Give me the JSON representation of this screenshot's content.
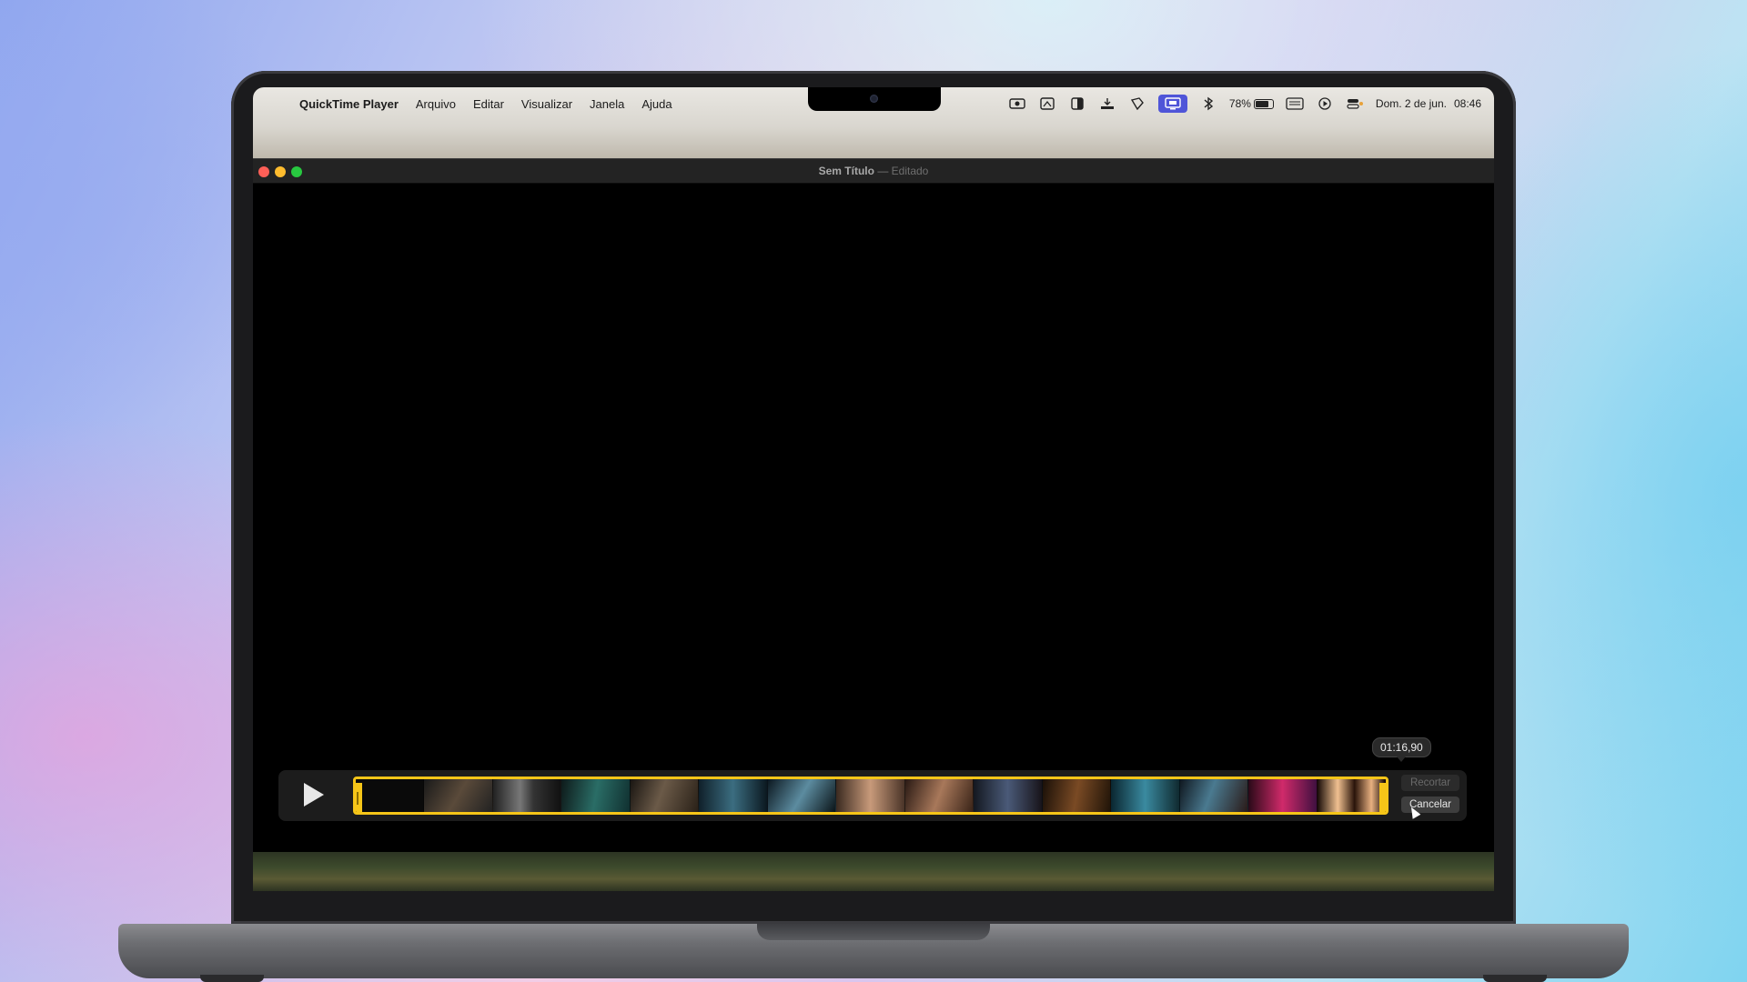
{
  "menubar": {
    "apple_icon": "",
    "app_name": "QuickTime Player",
    "menus": [
      "Arquivo",
      "Editar",
      "Visualizar",
      "Janela",
      "Ajuda"
    ],
    "status_icons": [
      "camera-record-icon",
      "screen-mirror-icon",
      "contrast-icon",
      "download-icon",
      "bookmark-icon",
      "display-share-icon",
      "bluetooth-icon"
    ],
    "battery_percent": "78%",
    "date": "Dom. 2 de jun.",
    "time": "08:46"
  },
  "window": {
    "title": "Sem Título",
    "separator": "—",
    "status": "Editado"
  },
  "trim": {
    "timecode": "01:16,90",
    "trim_label": "Recortar",
    "cancel_label": "Cancelar"
  },
  "colors": {
    "accent_yellow": "#f5c518",
    "active_menu_icon": "#4f55d8"
  }
}
